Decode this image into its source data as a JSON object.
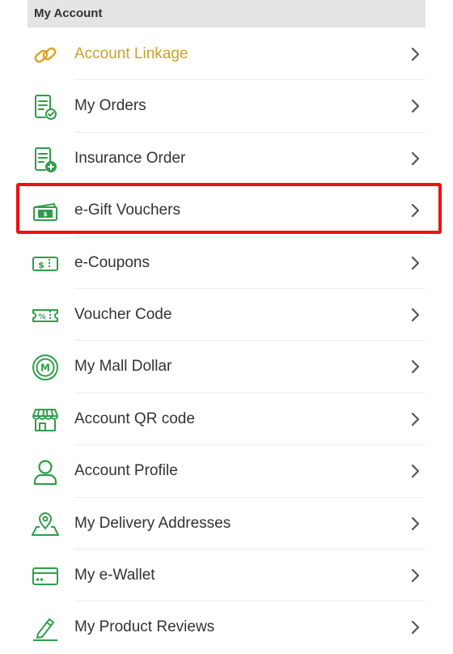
{
  "section": {
    "title": "My Account"
  },
  "colors": {
    "icon_green": "#2e9e4a",
    "highlight_gold": "#c9a227",
    "selection_red": "#ee1111"
  },
  "menu": {
    "items": [
      {
        "label": "Account Linkage",
        "icon": "link-icon",
        "highlight": true
      },
      {
        "label": "My Orders",
        "icon": "order-list-check-icon"
      },
      {
        "label": "Insurance Order",
        "icon": "insurance-order-icon"
      },
      {
        "label": "e-Gift Vouchers",
        "icon": "gift-voucher-icon",
        "selected": true
      },
      {
        "label": "e-Coupons",
        "icon": "coupon-icon"
      },
      {
        "label": "Voucher Code",
        "icon": "voucher-code-icon"
      },
      {
        "label": "My Mall Dollar",
        "icon": "mall-dollar-icon"
      },
      {
        "label": "Account QR code",
        "icon": "store-qr-icon"
      },
      {
        "label": "Account Profile",
        "icon": "person-icon"
      },
      {
        "label": "My Delivery Addresses",
        "icon": "map-pin-icon"
      },
      {
        "label": "My e-Wallet",
        "icon": "wallet-card-icon"
      },
      {
        "label": "My Product Reviews",
        "icon": "pencil-icon"
      }
    ]
  }
}
